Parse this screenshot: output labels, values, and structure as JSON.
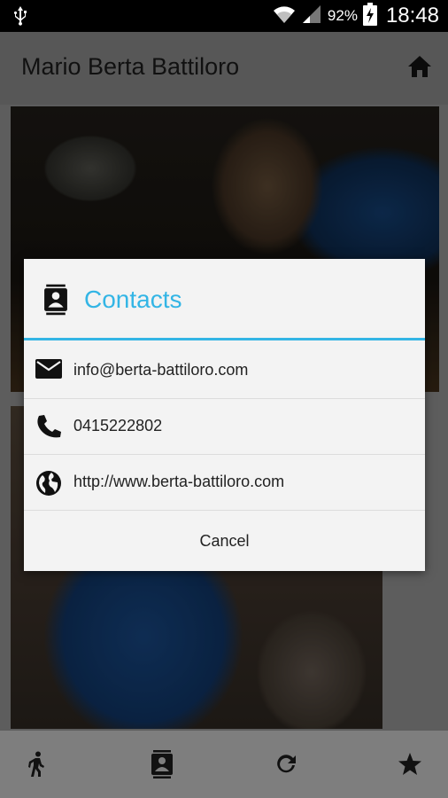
{
  "status_bar": {
    "battery": "92%",
    "time": "18:48",
    "icons": [
      "usb-icon",
      "wifi-icon",
      "signal-icon",
      "battery-charging-icon"
    ]
  },
  "app_bar": {
    "title": "Mario Berta Battiloro",
    "home_icon": "home-icon"
  },
  "dialog": {
    "title": "Contacts",
    "title_color": "#33b5e5",
    "items": [
      {
        "icon": "email-icon",
        "text": "info@berta-battiloro.com"
      },
      {
        "icon": "phone-icon",
        "text": "0415222802"
      },
      {
        "icon": "globe-icon",
        "text": "http://www.berta-battiloro.com"
      }
    ],
    "cancel_label": "Cancel"
  },
  "bottom_nav": [
    "walk-icon",
    "contacts-icon",
    "refresh-icon",
    "star-icon"
  ]
}
